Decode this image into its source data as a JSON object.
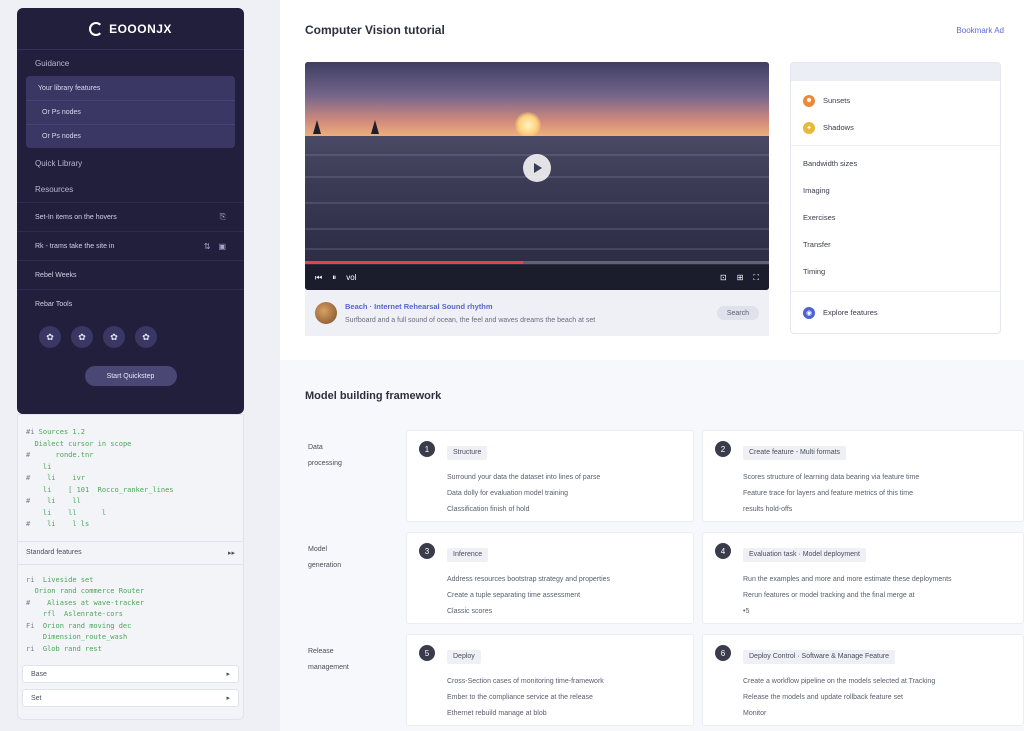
{
  "sidebar": {
    "brand": "EOOONJX",
    "sections": [
      "Guidance",
      "Quick Library",
      "Resources"
    ],
    "group_items": [
      "Your library features",
      "Or Ps nodes",
      "Or Ps nodes"
    ],
    "items": [
      {
        "label": "Set-In items on the hovers",
        "icon": "⎘",
        "extra": ""
      },
      {
        "label": "Rk - trams take the site in",
        "icon": "⇅",
        "extra": "▣"
      },
      {
        "label": "Rebel Weeks",
        "icon": "",
        "extra": ""
      },
      {
        "label": "Rebar Tools",
        "icon": "",
        "extra": ""
      }
    ],
    "icons": [
      "✿",
      "✿",
      "✿",
      "✿"
    ],
    "button": "Start Quickstep"
  },
  "code": {
    "lines": [
      {
        "g": "#i ",
        "t": "Sources 1.2"
      },
      {
        "g": "  ",
        "t": "Dialect cursor in scope"
      },
      {
        "g": "#  ",
        "t": "    ronde.tnr"
      },
      {
        "g": "  ",
        "t": "  li"
      },
      {
        "g": "#  ",
        "t": "  li    ivr"
      },
      {
        "g": "  ",
        "t": "  li    [ 101  Rocco_ranker_lines"
      },
      {
        "g": "#  ",
        "t": "  li    ll"
      },
      {
        "g": "  ",
        "t": "  li    ll      l"
      },
      {
        "g": "#  ",
        "t": "  li    l ls"
      }
    ],
    "header": "Standard features",
    "header_icon": "▸▸",
    "lines2": [
      {
        "g": "ri  ",
        "t": "Liveside set"
      },
      {
        "g": "  ",
        "t": "Orion rand commerce Router"
      },
      {
        "g": "#  ",
        "t": "  Aliases at wave-tracker"
      },
      {
        "g": "  ",
        "t": "  rfl  Aslenrate-cors"
      },
      {
        "g": "Fi  ",
        "t": "Orion rand moving dec"
      },
      {
        "g": "  ",
        "t": "  Dimension_route_wash"
      },
      {
        "g": "ri  ",
        "t": "Glob rand rest"
      }
    ],
    "select1": "Base",
    "select2": "Set",
    "chevron": "▸"
  },
  "main": {
    "title": "Computer Vision tutorial",
    "top_link": "Bookmark Ad",
    "video": {
      "progress": 0.47,
      "controls_left": [
        "⏮",
        "⏸",
        "vol"
      ],
      "controls_right": [
        "⊡",
        "⊞",
        "⛶"
      ],
      "title": "Beach · Internet Rehearsal Sound rhythm",
      "subtitle": "Surfboard and a full sound of ocean, the feel and waves dreams the beach at set",
      "pill": "Search"
    },
    "side": {
      "rows": [
        {
          "icon": "☻",
          "color": "#e98a3a",
          "label": "Sunsets"
        },
        {
          "icon": "✦",
          "color": "#e6b93a",
          "label": "Shadows"
        }
      ],
      "list": [
        "Bandwidth sizes",
        "Imaging",
        "Exercises",
        "Transfer",
        "Timing"
      ],
      "footer_icon": "◉",
      "footer_color": "#4c62d8",
      "footer": "Explore features"
    },
    "section_title": "Model building framework",
    "steps": [
      {
        "label": [
          "Data",
          "processing"
        ],
        "left": {
          "num": "1",
          "tag": "Structure",
          "text": [
            "Surround your data the dataset into lines of parse",
            "Data dolly for evaluation model training",
            "Classification finish of hold"
          ]
        },
        "right": {
          "num": "2",
          "tag": "Create feature - Multi formats",
          "text": [
            "Scores structure of learning data bearing via feature time",
            "Feature trace for layers and feature metrics of this time",
            "results hold-offs"
          ]
        }
      },
      {
        "label": [
          "Model",
          "generation"
        ],
        "left": {
          "num": "3",
          "tag": "Inference",
          "text": [
            "Address resources bootstrap strategy and properties",
            "Create a tuple separating time assessment",
            "Classic scores"
          ]
        },
        "right": {
          "num": "4",
          "tag": "Evaluation task · Model deployment",
          "text": [
            "Run the examples and more and more estimate these deployments",
            "Rerun features or model tracking and the final merge at",
            "•5"
          ]
        }
      },
      {
        "label": [
          "Release",
          "management"
        ],
        "left": {
          "num": "5",
          "tag": "Deploy",
          "text": [
            "Cross-Section cases of monitoring time-framework",
            "Ember to the compliance service at the release",
            "Ethernet rebuild manage at blob"
          ]
        },
        "right": {
          "num": "6",
          "tag": "Deploy Control · Software & Manage Feature",
          "text": [
            "Create a workflow pipeline on the models selected at Tracking",
            "Release the models and update rollback feature set",
            "Monitor"
          ]
        }
      }
    ]
  }
}
